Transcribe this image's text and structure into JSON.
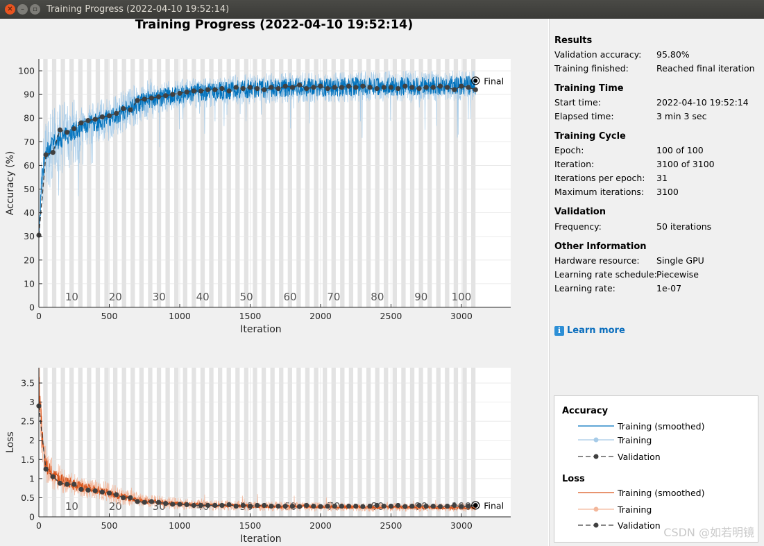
{
  "window": {
    "title": "Training Progress (2022-04-10 19:52:14)"
  },
  "main_title": "Training Progress (2022-04-10 19:52:14)",
  "results": {
    "heading": "Results",
    "validation_accuracy": {
      "label": "Validation accuracy:",
      "value": "95.80%"
    },
    "training_finished": {
      "label": "Training finished:",
      "value": "Reached final iteration"
    }
  },
  "training_time": {
    "heading": "Training Time",
    "start_time": {
      "label": "Start time:",
      "value": "2022-04-10 19:52:14"
    },
    "elapsed_time": {
      "label": "Elapsed time:",
      "value": "3 min 3 sec"
    }
  },
  "training_cycle": {
    "heading": "Training Cycle",
    "epoch": {
      "label": "Epoch:",
      "value": "100 of 100"
    },
    "iteration": {
      "label": "Iteration:",
      "value": "3100 of 3100"
    },
    "iterations_per_epoch": {
      "label": "Iterations per epoch:",
      "value": "31"
    },
    "maximum_iterations": {
      "label": "Maximum iterations:",
      "value": "3100"
    }
  },
  "validation": {
    "heading": "Validation",
    "frequency": {
      "label": "Frequency:",
      "value": "50 iterations"
    }
  },
  "other_information": {
    "heading": "Other Information",
    "hardware_resource": {
      "label": "Hardware resource:",
      "value": "Single GPU"
    },
    "learning_rate_schedule": {
      "label": "Learning rate schedule:",
      "value": "Piecewise"
    },
    "learning_rate": {
      "label": "Learning rate:",
      "value": "1e-07"
    }
  },
  "learn_more": "Learn more",
  "legend": {
    "accuracy_heading": "Accuracy",
    "loss_heading": "Loss",
    "training_smoothed": "Training (smoothed)",
    "training": "Training",
    "validation": "Validation"
  },
  "watermark": "CSDN @如若明镜",
  "colors": {
    "accuracy_smoothed": "#0072bd",
    "accuracy_raw": "#a6cbe8",
    "loss_smoothed": "#d95319",
    "loss_raw": "#f3b79b",
    "validation": "#404040",
    "epoch_band": "#e3e3e3"
  },
  "chart_data": [
    {
      "type": "line",
      "ylabel": "Accuracy (%)",
      "xlabel": "Iteration",
      "xlim": [
        0,
        3350
      ],
      "ylim": [
        0,
        105
      ],
      "xticks": [
        0,
        500,
        1000,
        1500,
        2000,
        2500,
        3000
      ],
      "yticks": [
        0,
        10,
        20,
        30,
        40,
        50,
        60,
        70,
        80,
        90,
        100
      ],
      "epoch_labels": [
        "10",
        "20",
        "30",
        "40",
        "50",
        "60",
        "70",
        "80",
        "90",
        "100"
      ],
      "iterations_per_epoch": 31,
      "final_label": "Final",
      "final_value": 95.8,
      "final_iteration": 3100,
      "series": [
        {
          "name": "Validation",
          "x": [
            0,
            50,
            100,
            150,
            200,
            250,
            300,
            350,
            400,
            450,
            500,
            550,
            600,
            650,
            700,
            750,
            800,
            850,
            900,
            950,
            1000,
            1050,
            1100,
            1150,
            1200,
            1250,
            1300,
            1350,
            1400,
            1450,
            1500,
            1550,
            1600,
            1650,
            1700,
            1750,
            1800,
            1850,
            1900,
            1950,
            2000,
            2050,
            2100,
            2150,
            2200,
            2250,
            2300,
            2350,
            2400,
            2450,
            2500,
            2550,
            2600,
            2650,
            2700,
            2750,
            2800,
            2850,
            2900,
            2950,
            3000,
            3050,
            3100
          ],
          "y": [
            30.5,
            64.5,
            65.5,
            75,
            74,
            75.5,
            78,
            79,
            79.5,
            80.5,
            81,
            82,
            84,
            83.5,
            87.5,
            88,
            88.5,
            89,
            89.5,
            90,
            90.5,
            91,
            91.5,
            91.5,
            92,
            92,
            92.5,
            91.5,
            93,
            92.5,
            93,
            92.5,
            92,
            93,
            92.5,
            93.5,
            93,
            94,
            92.5,
            93,
            93.5,
            92.5,
            93,
            93,
            93.5,
            93,
            93.5,
            93,
            92.5,
            93,
            93,
            92.5,
            93.5,
            93,
            92.5,
            93,
            93,
            93.5,
            93,
            92,
            93.5,
            93,
            92
          ]
        },
        {
          "name": "Training (smoothed)",
          "x": [
            0,
            20,
            40,
            60,
            100,
            150,
            200,
            300,
            400,
            500,
            600,
            700,
            800,
            900,
            1000,
            1200,
            1400,
            1600,
            1800,
            2000,
            2200,
            2400,
            2600,
            2800,
            3000,
            3100
          ],
          "y": [
            30,
            52,
            63,
            66,
            69,
            71,
            73,
            76,
            78,
            80,
            83,
            86,
            88,
            89,
            90,
            91,
            92,
            92.5,
            93,
            93,
            93.2,
            93.5,
            93.5,
            93.6,
            93.8,
            94
          ]
        }
      ]
    },
    {
      "type": "line",
      "ylabel": "Loss",
      "xlabel": "Iteration",
      "xlim": [
        0,
        3350
      ],
      "ylim": [
        0,
        3.9
      ],
      "xticks": [
        0,
        500,
        1000,
        1500,
        2000,
        2500,
        3000
      ],
      "yticks": [
        0,
        0.5,
        1,
        1.5,
        2,
        2.5,
        3,
        3.5
      ],
      "epoch_labels": [
        "10",
        "20",
        "30",
        "40",
        "50",
        "60",
        "70",
        "80",
        "90",
        "100"
      ],
      "final_label": "Final",
      "series": [
        {
          "name": "Validation",
          "x": [
            0,
            50,
            100,
            150,
            200,
            250,
            300,
            350,
            400,
            450,
            500,
            550,
            600,
            650,
            700,
            750,
            800,
            850,
            900,
            950,
            1000,
            1050,
            1100,
            1150,
            1200,
            1250,
            1300,
            1350,
            1400,
            1450,
            1500,
            1550,
            1600,
            1650,
            1700,
            1750,
            1800,
            1850,
            1900,
            1950,
            2000,
            2050,
            2100,
            2150,
            2200,
            2250,
            2300,
            2350,
            2400,
            2450,
            2500,
            2550,
            2600,
            2650,
            2700,
            2750,
            2800,
            2850,
            2900,
            2950,
            3000,
            3050,
            3100
          ],
          "y": [
            2.9,
            1.25,
            1.05,
            0.88,
            0.85,
            0.85,
            0.72,
            0.7,
            0.68,
            0.65,
            0.62,
            0.58,
            0.5,
            0.5,
            0.4,
            0.38,
            0.4,
            0.38,
            0.35,
            0.33,
            0.33,
            0.32,
            0.3,
            0.3,
            0.3,
            0.3,
            0.3,
            0.32,
            0.28,
            0.3,
            0.28,
            0.3,
            0.3,
            0.28,
            0.28,
            0.28,
            0.28,
            0.27,
            0.3,
            0.28,
            0.27,
            0.28,
            0.28,
            0.28,
            0.28,
            0.28,
            0.27,
            0.28,
            0.3,
            0.28,
            0.28,
            0.3,
            0.27,
            0.28,
            0.3,
            0.28,
            0.28,
            0.27,
            0.28,
            0.3,
            0.27,
            0.28,
            0.3
          ]
        },
        {
          "name": "Training (smoothed)",
          "x": [
            0,
            20,
            40,
            60,
            100,
            150,
            200,
            300,
            400,
            500,
            600,
            700,
            800,
            900,
            1000,
            1200,
            1400,
            1600,
            1800,
            2000,
            2200,
            2400,
            2600,
            2800,
            3000,
            3100
          ],
          "y": [
            3.6,
            2.2,
            1.5,
            1.3,
            1.1,
            1.0,
            0.9,
            0.78,
            0.7,
            0.62,
            0.52,
            0.45,
            0.4,
            0.37,
            0.34,
            0.31,
            0.29,
            0.28,
            0.27,
            0.26,
            0.26,
            0.25,
            0.25,
            0.24,
            0.24,
            0.24
          ]
        }
      ]
    }
  ]
}
